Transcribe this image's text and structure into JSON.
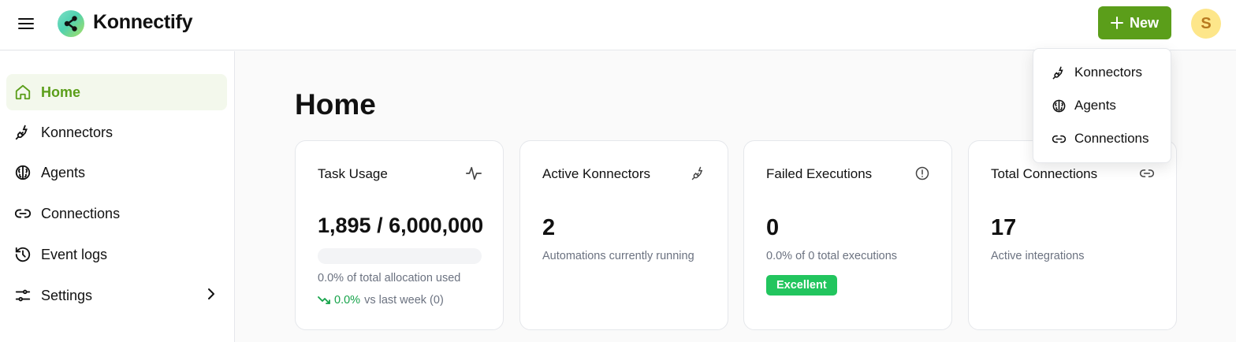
{
  "header": {
    "app_name": "Konnectify",
    "new_label": "New",
    "avatar_initial": "S"
  },
  "colors": {
    "brand": "#5b9e1a",
    "active_bg": "#f3f8ec",
    "success": "#22c55e",
    "avatar_bg": "#fde68a"
  },
  "sidebar": {
    "items": [
      {
        "label": "Home",
        "icon": "home-icon",
        "active": true
      },
      {
        "label": "Konnectors",
        "icon": "plug-icon"
      },
      {
        "label": "Agents",
        "icon": "brain-icon"
      },
      {
        "label": "Connections",
        "icon": "link-icon"
      },
      {
        "label": "Event logs",
        "icon": "history-icon"
      },
      {
        "label": "Settings",
        "icon": "sliders-icon",
        "has_submenu": true
      }
    ]
  },
  "main": {
    "title": "Home",
    "cards": {
      "task_usage": {
        "title": "Task Usage",
        "icon": "activity-icon",
        "value": "1,895 / 6,000,000",
        "progress_percent": 0.0,
        "allocation_text": "0.0% of total allocation used",
        "trend_percent": "0.0%",
        "trend_text": "vs last week (0)"
      },
      "active_konnectors": {
        "title": "Active Konnectors",
        "icon": "plug-icon",
        "value": "2",
        "subtitle": "Automations currently running"
      },
      "failed_executions": {
        "title": "Failed Executions",
        "icon": "alert-circle-icon",
        "value": "0",
        "subtitle": "0.0% of 0 total executions",
        "badge": "Excellent"
      },
      "total_connections": {
        "title": "Total Connections",
        "icon": "link-icon",
        "value": "17",
        "subtitle": "Active integrations"
      }
    }
  },
  "new_dropdown": {
    "items": [
      {
        "label": "Konnectors",
        "icon": "plug-icon"
      },
      {
        "label": "Agents",
        "icon": "brain-icon"
      },
      {
        "label": "Connections",
        "icon": "link-icon"
      }
    ]
  }
}
